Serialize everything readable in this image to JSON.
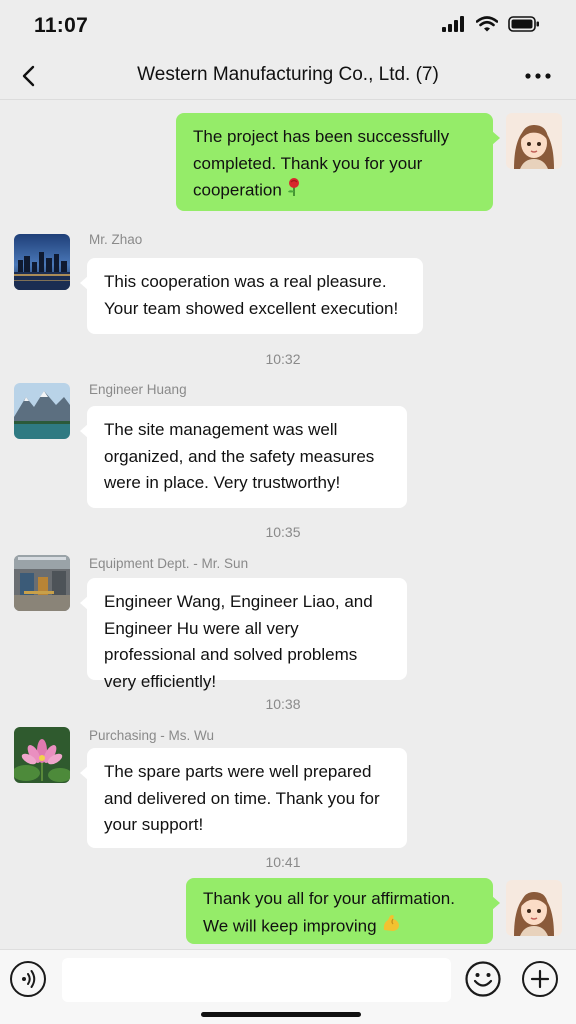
{
  "status_bar": {
    "time": "11:07"
  },
  "nav": {
    "title": "Western Manufacturing Co., Ltd. (7)"
  },
  "messages": [
    {
      "side": "right",
      "text": "The project has been successfully completed. Thank you for your cooperation",
      "emoji": "rose"
    },
    {
      "side": "left",
      "sender": "Mr. Zhao",
      "text": "This cooperation was a real pleasure. Your team showed excellent execution!"
    },
    {
      "timestamp": "10:32"
    },
    {
      "side": "left",
      "sender": "Engineer Huang",
      "text": "The site management was well organized, and the safety measures were in place. Very trustworthy!"
    },
    {
      "timestamp": "10:35"
    },
    {
      "side": "left",
      "sender": "Equipment Dept. - Mr. Sun",
      "text": "Engineer Wang, Engineer Liao, and Engineer Hu were all very professional and solved problems very efficiently!"
    },
    {
      "timestamp": "10:38"
    },
    {
      "side": "left",
      "sender": "Purchasing - Ms. Wu",
      "text": "The spare parts were well prepared and delivered on time. Thank you for your support!"
    },
    {
      "timestamp": "10:41"
    },
    {
      "side": "right",
      "text": "Thank you all for your affirmation. We will keep improving",
      "emoji": "flexed-biceps"
    }
  ],
  "input_bar": {
    "value": "",
    "placeholder": ""
  },
  "colors": {
    "background": "#ededed",
    "sent_bubble": "#95ec69",
    "received_bubble": "#ffffff"
  }
}
